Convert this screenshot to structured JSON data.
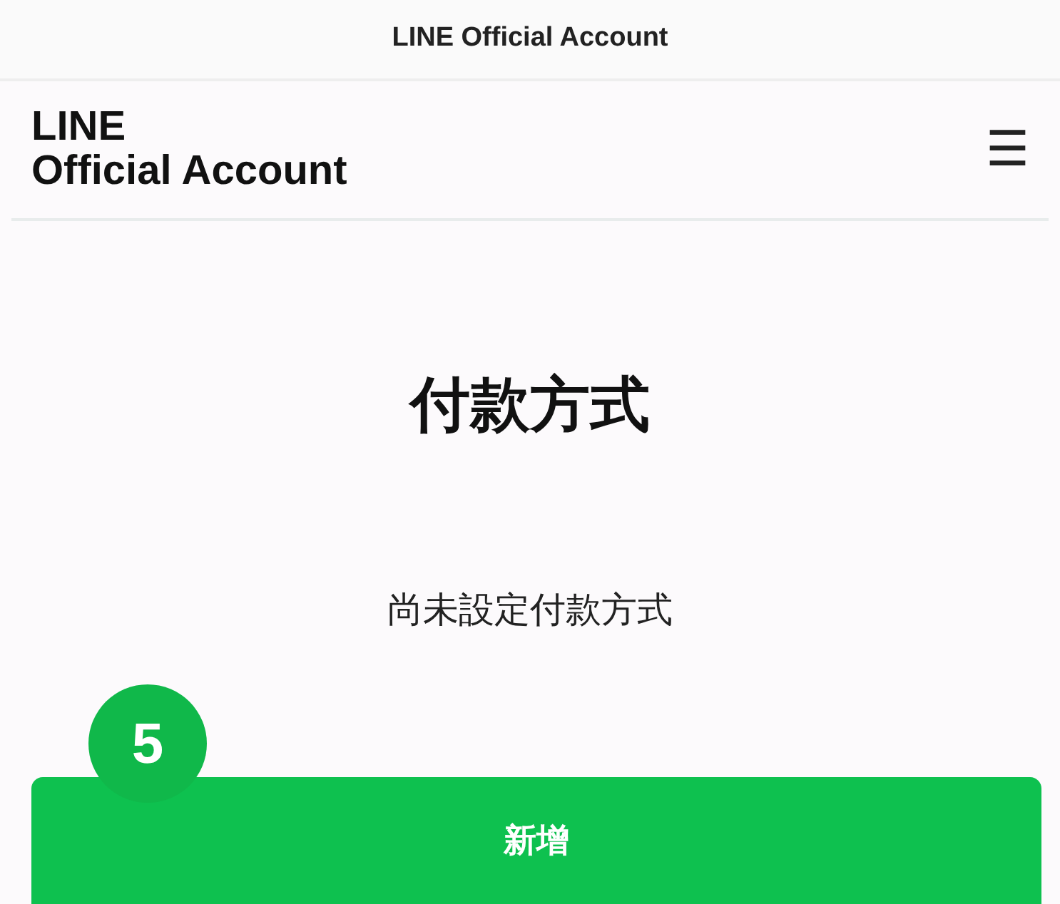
{
  "status_title": "LINE Official Account",
  "header": {
    "logo_lines": [
      "LINE",
      "Official Account"
    ],
    "menu_glyph": "☰"
  },
  "page": {
    "title": "付款方式",
    "message": "尚未設定付款方式"
  },
  "step_badge": "5",
  "buttons": [
    {
      "label": "新增"
    }
  ]
}
